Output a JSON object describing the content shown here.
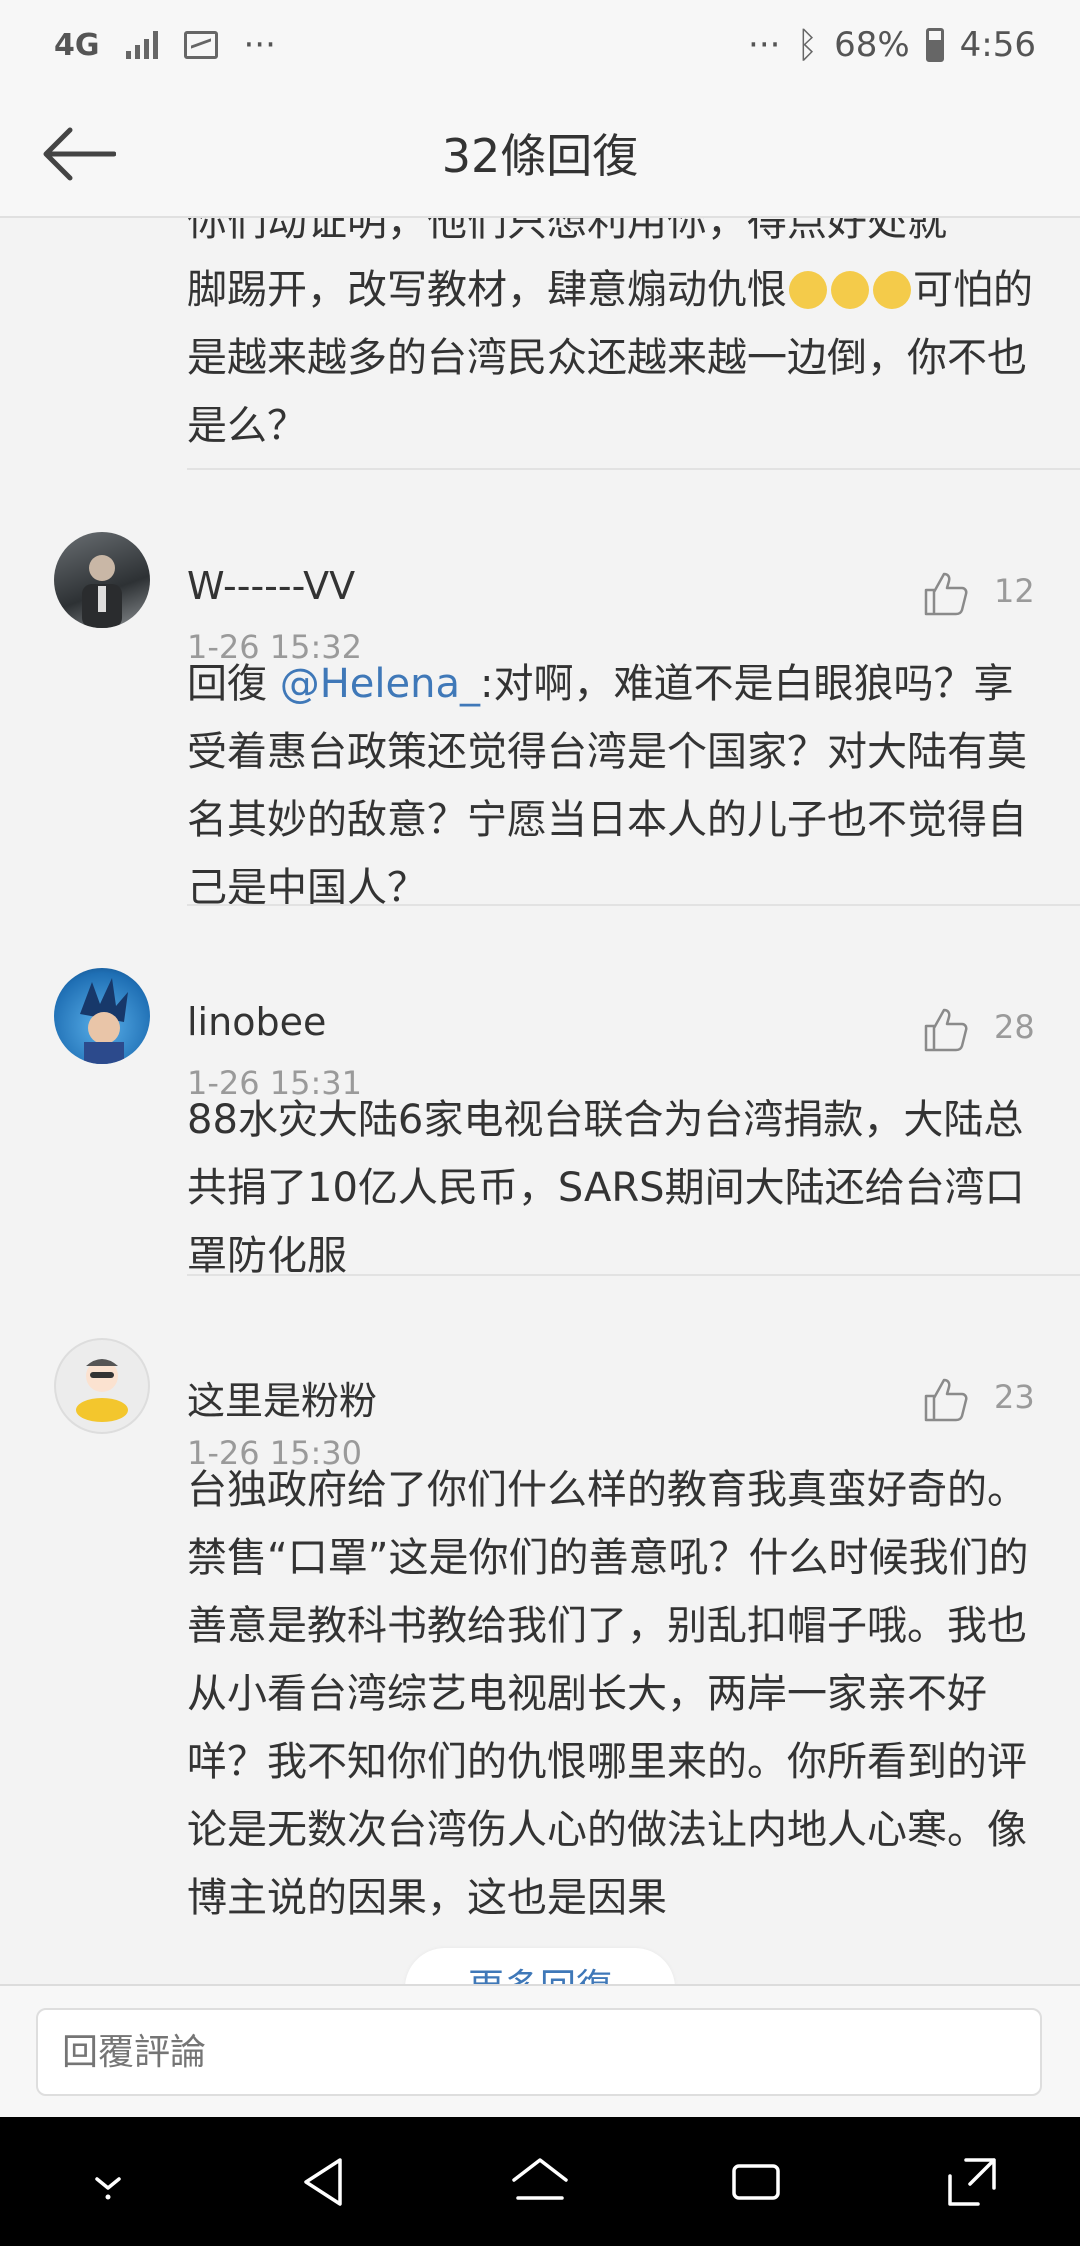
{
  "status_bar": {
    "network": "4G",
    "overflow_left": "···",
    "overflow_right": "···",
    "battery": "68%",
    "time": "4:56"
  },
  "header": {
    "title": "32條回復"
  },
  "top_partial": {
    "line1": "你们动证明，他们只想利用你，得点好处就",
    "text_before_emoji": "脚踢开，改写教材，肆意煽动仇恨",
    "text_after_emoji": "可怕的是越来越多的台湾民众还越来越一边倒，你不也是么？",
    "emoji_count": 3
  },
  "comments": [
    {
      "username": "W------VV",
      "time": "1-26 15:32",
      "likes": "12",
      "reply_prefix": "回復 ",
      "mention": "@Helena_",
      "text": ":对啊，难道不是白眼狼吗？享受着惠台政策还觉得台湾是个国家？对大陆有莫名其妙的敌意？宁愿当日本人的儿子也不觉得自己是中国人？"
    },
    {
      "username": "linobee",
      "time": "1-26 15:31",
      "likes": "28",
      "text": "88水灾大陆6家电视台联合为台湾捐款，大陆总共捐了10亿人民币，SARS期间大陆还给台湾口罩防化服"
    },
    {
      "username": "这里是粉粉",
      "time": "1-26 15:30",
      "likes": "23",
      "text": "台独政府给了你们什么样的教育我真蛮好奇的。禁售“口罩”这是你们的善意吼？什么时候我们的善意是教科书教给我们了，别乱扣帽子哦。我也从小看台湾综艺电视剧长大，两岸一家亲不好咩？我不知你们的仇恨哪里来的。你所看到的评论是无数次台湾伤人心的做法让内地人心寒。像博主说的因果，这也是因果"
    }
  ],
  "more_replies": "更多回復",
  "reply_input": {
    "placeholder": "回覆評論"
  },
  "colors": {
    "background": "#f3f3f3",
    "mention": "#3f78b8",
    "meta": "#9a9a9a",
    "nav_bar": "#000000"
  }
}
